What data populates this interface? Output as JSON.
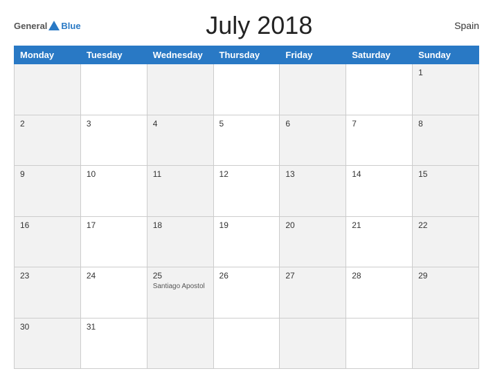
{
  "header": {
    "logo_general": "General",
    "logo_blue": "Blue",
    "title": "July 2018",
    "country": "Spain"
  },
  "weekdays": [
    "Monday",
    "Tuesday",
    "Wednesday",
    "Thursday",
    "Friday",
    "Saturday",
    "Sunday"
  ],
  "weeks": [
    [
      {
        "day": "",
        "event": ""
      },
      {
        "day": "",
        "event": ""
      },
      {
        "day": "",
        "event": ""
      },
      {
        "day": "",
        "event": ""
      },
      {
        "day": "",
        "event": ""
      },
      {
        "day": "",
        "event": ""
      },
      {
        "day": "1",
        "event": ""
      }
    ],
    [
      {
        "day": "2",
        "event": ""
      },
      {
        "day": "3",
        "event": ""
      },
      {
        "day": "4",
        "event": ""
      },
      {
        "day": "5",
        "event": ""
      },
      {
        "day": "6",
        "event": ""
      },
      {
        "day": "7",
        "event": ""
      },
      {
        "day": "8",
        "event": ""
      }
    ],
    [
      {
        "day": "9",
        "event": ""
      },
      {
        "day": "10",
        "event": ""
      },
      {
        "day": "11",
        "event": ""
      },
      {
        "day": "12",
        "event": ""
      },
      {
        "day": "13",
        "event": ""
      },
      {
        "day": "14",
        "event": ""
      },
      {
        "day": "15",
        "event": ""
      }
    ],
    [
      {
        "day": "16",
        "event": ""
      },
      {
        "day": "17",
        "event": ""
      },
      {
        "day": "18",
        "event": ""
      },
      {
        "day": "19",
        "event": ""
      },
      {
        "day": "20",
        "event": ""
      },
      {
        "day": "21",
        "event": ""
      },
      {
        "day": "22",
        "event": ""
      }
    ],
    [
      {
        "day": "23",
        "event": ""
      },
      {
        "day": "24",
        "event": ""
      },
      {
        "day": "25",
        "event": "Santiago Apostol"
      },
      {
        "day": "26",
        "event": ""
      },
      {
        "day": "27",
        "event": ""
      },
      {
        "day": "28",
        "event": ""
      },
      {
        "day": "29",
        "event": ""
      }
    ],
    [
      {
        "day": "30",
        "event": ""
      },
      {
        "day": "31",
        "event": ""
      },
      {
        "day": "",
        "event": ""
      },
      {
        "day": "",
        "event": ""
      },
      {
        "day": "",
        "event": ""
      },
      {
        "day": "",
        "event": ""
      },
      {
        "day": "",
        "event": ""
      }
    ]
  ]
}
